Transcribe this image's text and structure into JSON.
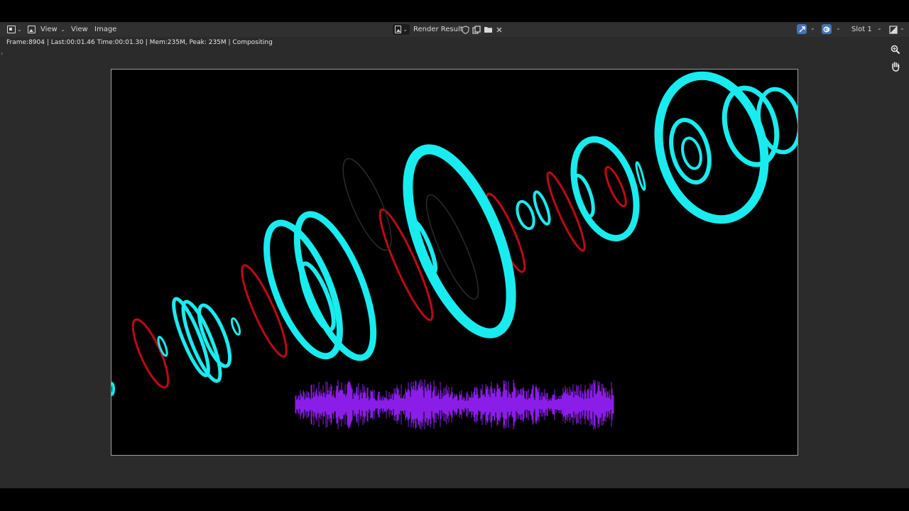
{
  "header": {
    "menus": [
      {
        "label": "View",
        "dropdown": true
      },
      {
        "label": "View",
        "dropdown": false
      },
      {
        "label": "Image",
        "dropdown": false
      }
    ],
    "image_name": "Render Result",
    "slot": "Slot 1"
  },
  "status_bar": {
    "text": "Frame:8904 | Last:00:01.46 Time:00:01.30 | Mem:235M, Peak: 235M | Compositing"
  },
  "icons": {
    "editor_type": "image-editor-icon",
    "image_browse": "image-icon",
    "fake_user": "shield-icon",
    "new_image": "duplicate-icon",
    "open_image": "folder-icon",
    "unlink": "close-icon",
    "zoom": "zoom-icon",
    "pan": "hand-icon",
    "gizmo": "gizmo-toggle-icon",
    "overlay": "overlay-toggle-icon",
    "display_channels": "channels-icon"
  },
  "colors": {
    "ring": "#19ecef",
    "red_rim": "#e0101a",
    "waveform": "#8a1ee8",
    "accent": "#4772b3",
    "editor_bg": "#2b2b2b"
  }
}
